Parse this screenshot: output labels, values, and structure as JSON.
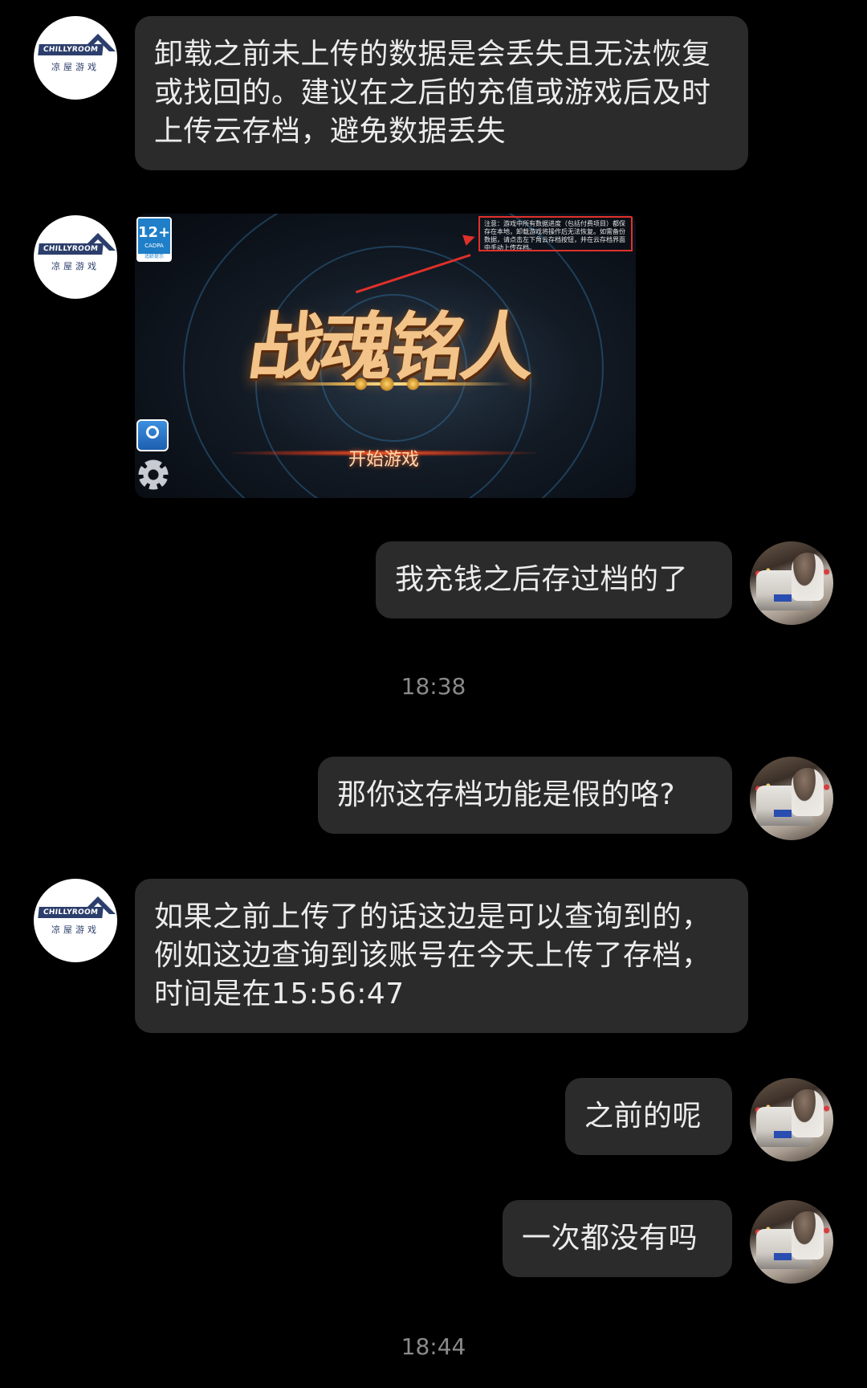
{
  "messages": [
    {
      "id": "m1",
      "sender": "support",
      "text": "卸载之前未上传的数据是会丢失且无法恢复或找回的。建议在之后的充值或游戏后及时上传云存档，避免数据丢失"
    },
    {
      "id": "m2",
      "sender": "support",
      "type": "image",
      "image": {
        "age_rating": "12+",
        "age_org": "CADPA",
        "age_note": "适龄提示",
        "notice_text": "注意：游戏中所有数据进度（包括付费项目）都保存在本地，卸载游戏将操作后无法恢复。如需备份数据，请点击左下角云存档按钮，并在云存档界面中手动上传存档。",
        "game_title": "战魂铭人",
        "start_label": "开始游戏"
      }
    },
    {
      "id": "m3",
      "sender": "user",
      "text": "我充钱之后存过档的了"
    },
    {
      "id": "m4",
      "sender": "user",
      "text": "那你这存档功能是假的咯?"
    },
    {
      "id": "m5",
      "sender": "support",
      "text": "如果之前上传了的话这边是可以查询到的，例如这边查询到该账号在今天上传了存档，时间是在15:56:47"
    },
    {
      "id": "m6",
      "sender": "user",
      "text": "之前的呢"
    },
    {
      "id": "m7",
      "sender": "user",
      "text": "一次都没有吗"
    }
  ],
  "timestamps": {
    "t1": "18:38",
    "t2": "18:44"
  },
  "support_avatar": {
    "logo_top": "CHILLYROOM",
    "logo_bottom": "凉屋游戏"
  },
  "colors": {
    "background": "#000000",
    "bubble": "#2b2b2b",
    "text": "#ececec",
    "timestamp": "#8a8a8a",
    "logo_blue": "#2c3e6b"
  }
}
